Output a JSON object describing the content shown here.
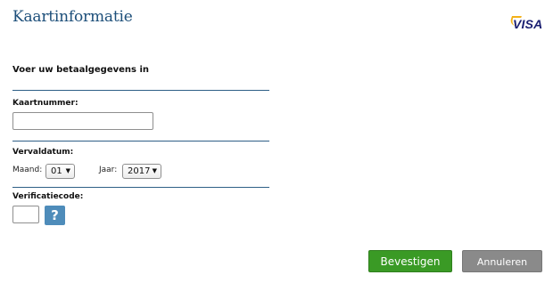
{
  "header": {
    "title": "Kaartinformatie",
    "card_brand": "VISA"
  },
  "form": {
    "heading": "Voer uw betaalgegevens in",
    "card_number": {
      "label": "Kaartnummer:",
      "value": ""
    },
    "expiry": {
      "label": "Vervaldatum:",
      "month_label": "Maand:",
      "month_value": "01",
      "year_label": "Jaar:",
      "year_value": "2017"
    },
    "verification": {
      "label": "Verificatiecode:",
      "value": "",
      "help_symbol": "?"
    }
  },
  "actions": {
    "confirm_label": "Bevestigen",
    "cancel_label": "Annuleren"
  },
  "colors": {
    "title": "#1d4f7a",
    "divider": "#2e5f86",
    "confirm": "#3a9a25",
    "cancel": "#8a8a8a",
    "help": "#4e8cba"
  }
}
